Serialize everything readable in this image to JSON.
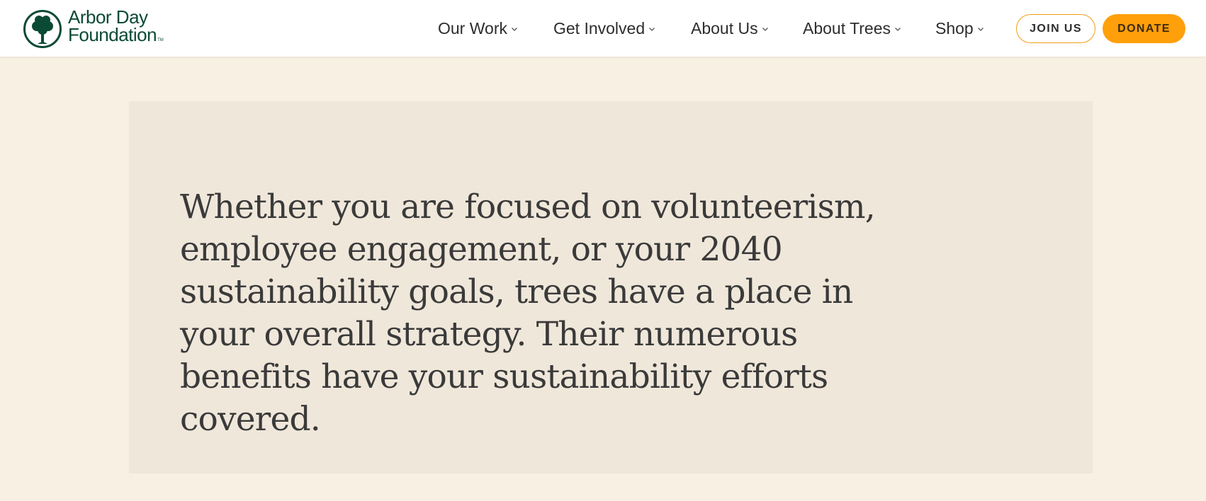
{
  "brand": {
    "line1": "Arbor Day",
    "line2": "Foundation",
    "tm": "TM",
    "color": "#0b4a34"
  },
  "nav": {
    "items": [
      {
        "label": "Our Work",
        "icon": "chevron-down-icon"
      },
      {
        "label": "Get Involved",
        "icon": "chevron-down-icon"
      },
      {
        "label": "About Us",
        "icon": "chevron-down-icon"
      },
      {
        "label": "About Trees",
        "icon": "chevron-down-icon"
      },
      {
        "label": "Shop",
        "icon": "chevron-down-icon"
      }
    ]
  },
  "actions": {
    "join_label": "JOIN US",
    "donate_label": "DONATE",
    "accent": "#ff9f0a"
  },
  "main": {
    "quote": "Whether you are focused on volunteerism, employee engagement, or your 2040 sustainability goals, trees have a place in your overall strategy. Their numerous benefits have your sustainability efforts covered."
  },
  "colors": {
    "page_bg": "#f8f0e3",
    "card_bg": "#efe7da",
    "text": "#3a3a3a"
  }
}
